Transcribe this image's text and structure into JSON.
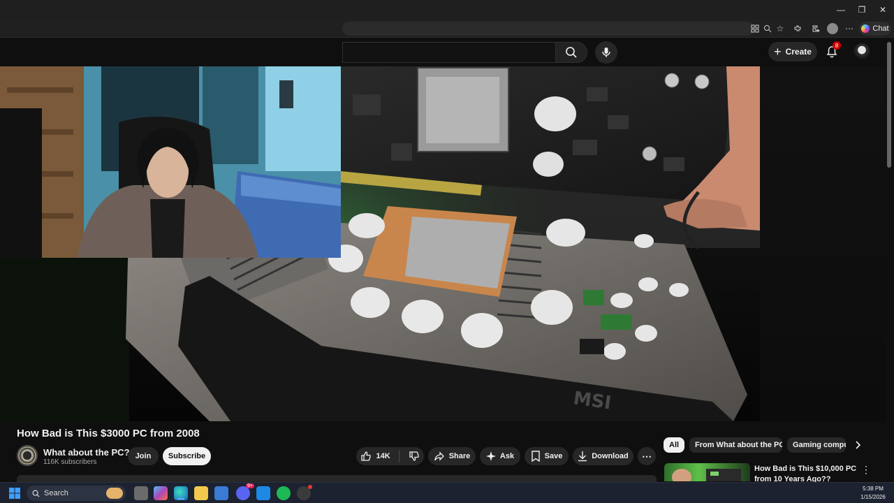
{
  "window": {
    "min": "—",
    "restore": "❐",
    "close": "✕"
  },
  "browser": {
    "chat_label": "Chat"
  },
  "header": {
    "create_label": "Create",
    "notification_count": "8"
  },
  "video": {
    "title": "How Bad is This $3000 PC from 2008",
    "brand_text": "MSI"
  },
  "channel": {
    "name": "What about the PC?",
    "subscribers": "116K subscribers",
    "join_label": "Join",
    "subscribe_label": "Subscribe"
  },
  "actions": {
    "likes": "14K",
    "share": "Share",
    "ask": "Ask",
    "save": "Save",
    "download": "Download"
  },
  "chips": [
    "All",
    "From What about the PC?",
    "Gaming compu"
  ],
  "recommendation": {
    "title": "How Bad is This $10,000 PC from 10 Years Ago??"
  },
  "taskbar": {
    "search_label": "Search",
    "time": "5:38 PM",
    "date": "1/15/2026",
    "discord_badge": "9+"
  },
  "colors": {
    "accent_red": "#cc0000",
    "bg": "#0f0f0f",
    "pill": "#272727"
  }
}
